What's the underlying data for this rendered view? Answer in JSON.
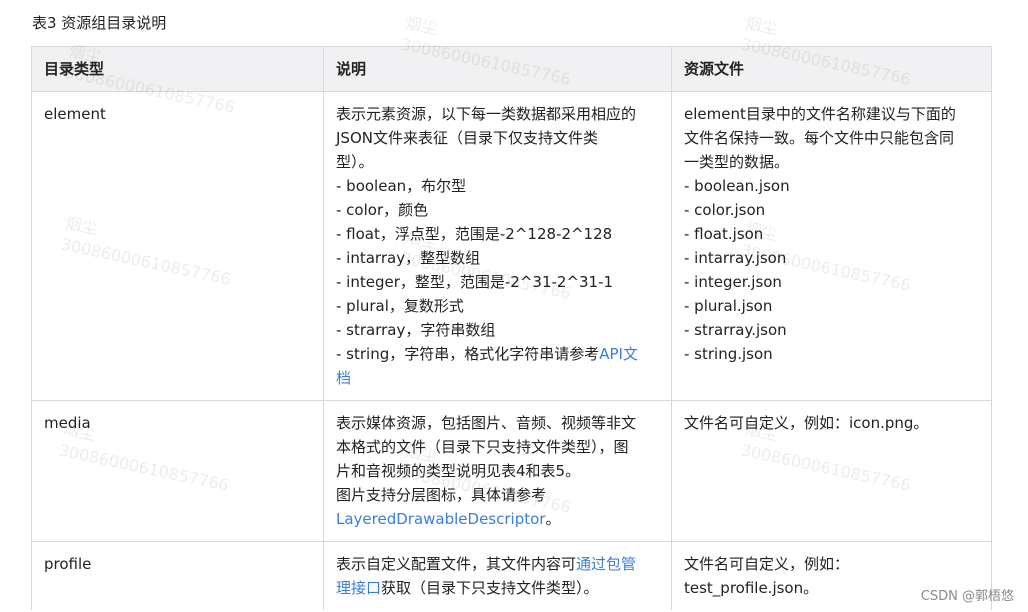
{
  "caption": "表3 资源组目录说明",
  "table": {
    "headers": [
      "目录类型",
      "说明",
      "资源文件"
    ],
    "rows": [
      {
        "type": "element",
        "desc": [
          "表示元素资源，以下每一类数据都采用相应的",
          "JSON文件来表征（目录下仅支持文件类",
          "型）。",
          "- boolean，布尔型",
          "- color，颜色",
          "- float，浮点型，范围是-2^128-2^128",
          "- intarray，整型数组",
          "- integer，整型，范围是-2^31-2^31-1",
          "- plural，复数形式",
          "- strarray，字符串数组"
        ],
        "desc_tail_text": "- string，字符串，格式化字符串请参考",
        "desc_tail_link1": "API文",
        "desc_tail_link2": "档",
        "files": [
          "element目录中的文件名称建议与下面的",
          "文件名保持一致。每个文件中只能包含同",
          "一类型的数据。",
          "- boolean.json",
          "- color.json",
          "- float.json",
          "- intarray.json",
          "- integer.json",
          "- plural.json",
          "- strarray.json",
          "- string.json"
        ]
      },
      {
        "type": "media",
        "desc": [
          "表示媒体资源，包括图片、音频、视频等非文",
          "本格式的文件（目录下只支持文件类型），图",
          "片和音视频的类型说明见表4和表5。",
          "图片支持分层图标，具体请参考"
        ],
        "desc_link": "LayeredDrawableDescriptor",
        "desc_link_suffix": "。",
        "files": [
          "文件名可自定义，例如：icon.png。"
        ]
      },
      {
        "type": "profile",
        "desc_pre": "表示自定义配置文件，其文件内容可",
        "desc_link1": "通过包管",
        "desc_link2": "理接口",
        "desc_post": "获取（目录下只支持文件类型）。",
        "files": [
          "文件名可自定义，例如：",
          "test_profile.json。"
        ]
      }
    ]
  },
  "watermark": {
    "name": "烟尘",
    "number": "30086000610857766"
  },
  "credit": "CSDN @郭梧悠"
}
